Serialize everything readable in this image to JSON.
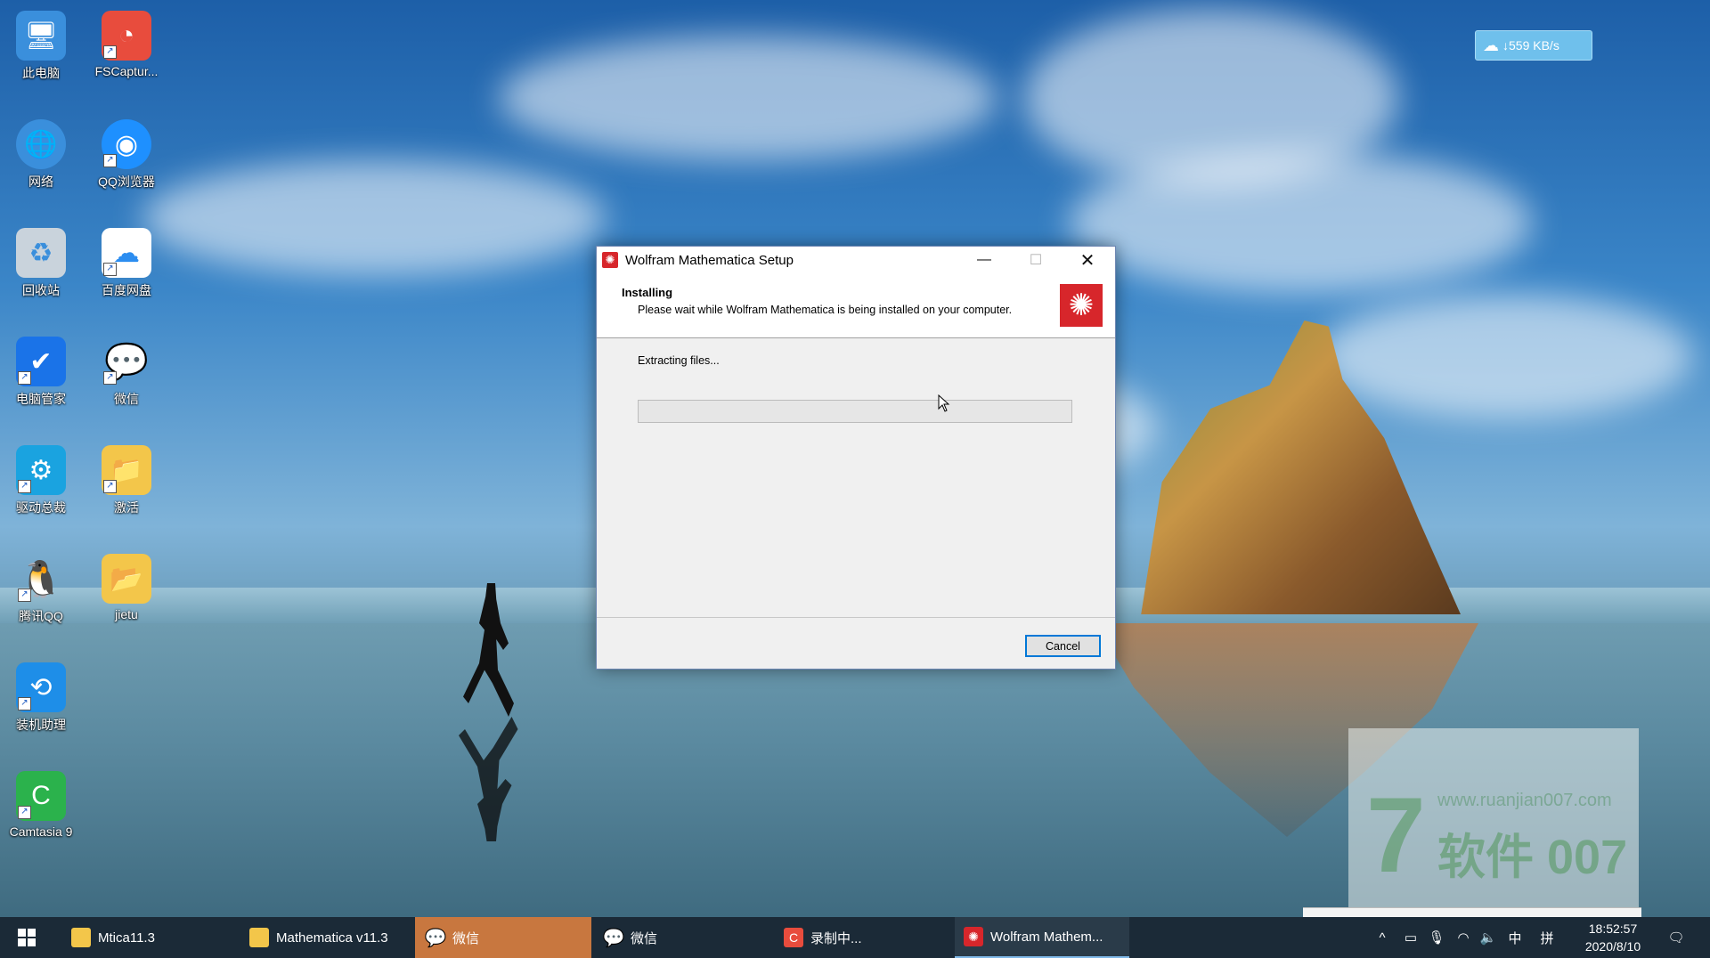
{
  "desktop": {
    "icons": [
      {
        "label": "此电脑",
        "icon": "computer-icon",
        "color": "#3a8fdc"
      },
      {
        "label": "FSCaptur...",
        "icon": "fscapture-icon",
        "color": "#e84c3d"
      },
      {
        "label": "网络",
        "icon": "network-icon",
        "color": "#3a8fdc"
      },
      {
        "label": "QQ浏览器",
        "icon": "qq-browser-icon",
        "color": "#1e90ff"
      },
      {
        "label": "回收站",
        "icon": "recycle-bin-icon",
        "color": "#9aa8b5"
      },
      {
        "label": "百度网盘",
        "icon": "baidu-netdisk-icon",
        "color": "#2c8df0"
      },
      {
        "label": "电脑管家",
        "icon": "pc-manager-icon",
        "color": "#1a73e8"
      },
      {
        "label": "微信",
        "icon": "wechat-icon",
        "color": "#2dc100"
      },
      {
        "label": "驱动总裁",
        "icon": "driver-icon",
        "color": "#1aa3e0"
      },
      {
        "label": "激活",
        "icon": "activate-icon",
        "color": "#f3c64a"
      },
      {
        "label": "腾讯QQ",
        "icon": "qq-icon",
        "color": "#111111"
      },
      {
        "label": "jietu",
        "icon": "folder-icon",
        "color": "#f3c64a"
      },
      {
        "label": "装机助理",
        "icon": "install-assistant-icon",
        "color": "#1e8ee8"
      },
      {
        "label": "Camtasia 9",
        "icon": "camtasia-icon",
        "color": "#2bb24c"
      }
    ]
  },
  "speed_widget": {
    "text": "↓559 KB/s"
  },
  "watermark": {
    "url": "www.ruanjian007.com",
    "brand": "软件 007",
    "digit": "7"
  },
  "window": {
    "title": "Wolfram Mathematica Setup",
    "minimize": "—",
    "maximize": "☐",
    "close": "✕",
    "header_title": "Installing",
    "header_subtitle": "Please wait while Wolfram Mathematica is being installed on your computer.",
    "status": "Extracting files...",
    "progress_fraction": 0.0,
    "cancel_label": "Cancel",
    "accent": "#d7262b"
  },
  "taskbar": {
    "items": [
      {
        "label": "Mtica11.3",
        "icon": "folder-icon",
        "state": "normal"
      },
      {
        "label": "Mathematica v11.3",
        "icon": "folder-icon",
        "state": "normal"
      },
      {
        "label": "微信",
        "icon": "wechat-icon",
        "state": "flash"
      },
      {
        "label": "微信",
        "icon": "wechat-icon",
        "state": "normal"
      },
      {
        "label": "录制中...",
        "icon": "camtasia-recorder-icon",
        "state": "normal"
      },
      {
        "label": "Wolfram Mathem...",
        "icon": "wolfram-icon",
        "state": "active"
      }
    ],
    "tray": {
      "chevron": "^",
      "ime_lang": "中",
      "ime_mode": "拼"
    },
    "clock": {
      "time": "18:52:57",
      "date": "2020/8/10"
    }
  }
}
